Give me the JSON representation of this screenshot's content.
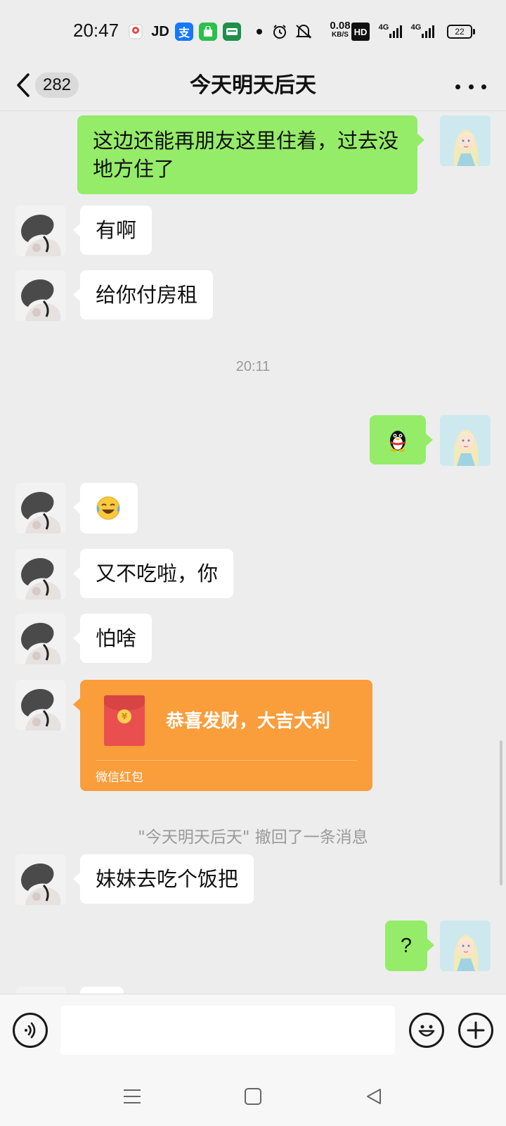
{
  "status_bar": {
    "time": "20:47",
    "net_speed_value": "0.08",
    "net_speed_unit": "KB/S",
    "hd_label": "HD",
    "network_1": "4G",
    "network_2": "4G",
    "battery": "22",
    "app_icons": [
      "map-pin-icon",
      "jd-icon",
      "alipay-icon",
      "shop-bag-icon",
      "wallet-icon"
    ],
    "jd_label": "JD",
    "alipay_label": "支"
  },
  "nav": {
    "unread_count": "282",
    "title": "今天明天后天"
  },
  "messages": [
    {
      "side": "right",
      "type": "text",
      "text_line1": "这边还能再朋友这里住着，过去没",
      "text_line2": "地方住了"
    },
    {
      "side": "left",
      "type": "text",
      "text": "有啊"
    },
    {
      "side": "left",
      "type": "text",
      "text": "给你付房租"
    },
    {
      "type": "time",
      "text": "20:11"
    },
    {
      "side": "right",
      "type": "sticker",
      "icon": "qq-penguin-icon"
    },
    {
      "side": "left",
      "type": "emoji",
      "icon": "laughing-crying-emoji-icon"
    },
    {
      "side": "left",
      "type": "text",
      "text": "又不吃啦，你"
    },
    {
      "side": "left",
      "type": "text",
      "text": "怕啥"
    },
    {
      "side": "left",
      "type": "red_packet",
      "title": "恭喜发财，大吉大利",
      "label": "微信红包"
    },
    {
      "type": "recall",
      "text": "\"今天明天后天\" 撤回了一条消息"
    },
    {
      "side": "left",
      "type": "text",
      "text": "妹妹去吃个饭把"
    },
    {
      "side": "right",
      "type": "text",
      "text": "?"
    }
  ],
  "input_bar": {
    "voice_icon": "voice-icon",
    "emoji_icon": "emoji-icon",
    "add_icon": "plus-icon",
    "placeholder": ""
  },
  "colors": {
    "background": "#ededed",
    "self_bubble": "#95ec69",
    "contact_bubble": "#ffffff",
    "red_packet": "#fa9d3b"
  }
}
